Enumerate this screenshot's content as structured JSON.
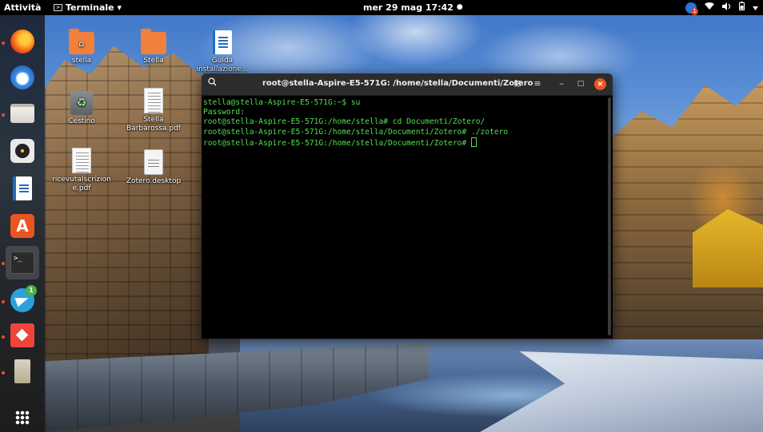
{
  "topbar": {
    "activities": "Attività",
    "app_menu": "Terminale ▾",
    "clock": "mer 29 mag  17:42",
    "clock_dot": "●",
    "update_count": "1",
    "tray_icons": [
      "wifi-icon",
      "volume-icon",
      "battery-icon",
      "chevron-down-icon"
    ]
  },
  "dock": {
    "items": [
      {
        "name": "firefox",
        "running": true
      },
      {
        "name": "thunderbird",
        "running": false
      },
      {
        "name": "files",
        "running": true
      },
      {
        "name": "rhythmbox",
        "running": false
      },
      {
        "name": "libreoffice-writer",
        "running": false
      },
      {
        "name": "ubuntu-software",
        "running": false
      },
      {
        "name": "terminal",
        "running": true
      },
      {
        "name": "telegram",
        "running": true,
        "badge": "1"
      },
      {
        "name": "anydesk",
        "running": true
      },
      {
        "name": "zotero",
        "running": true
      },
      {
        "name": "show-applications",
        "running": false
      }
    ],
    "terminal_glyph": ">_"
  },
  "desktop": {
    "icons": [
      {
        "label": "stella"
      },
      {
        "label": "Stella"
      },
      {
        "label": "Guida installazione..."
      },
      {
        "label": "Cestino"
      },
      {
        "label": "Stella Barbarossa.pdf"
      },
      {
        "label": "ricevutaIscrizione.pdf"
      },
      {
        "label": "Zotero.desktop"
      }
    ],
    "home_glyph": "⌂",
    "trash_glyph": "♻"
  },
  "terminal": {
    "title": "root@stella-Aspire-E5-571G: /home/stella/Documenti/Zotero",
    "search_glyph": "🔍",
    "tab_glyph": "⊞",
    "menu_glyph": "≡",
    "min_glyph": "–",
    "max_glyph": "□",
    "close_glyph": "×",
    "lines": [
      "stella@stella-Aspire-E5-571G:~$ su",
      "Password:",
      "root@stella-Aspire-E5-571G:/home/stella# cd Documenti/Zotero/",
      "root@stella-Aspire-E5-571G:/home/stella/Documenti/Zotero# ./zotero",
      "root@stella-Aspire-E5-571G:/home/stella/Documenti/Zotero# "
    ],
    "text_color": "#4fe04f",
    "background": "#000000"
  },
  "colors": {
    "accent": "#e95420",
    "topbar": "#000000"
  }
}
